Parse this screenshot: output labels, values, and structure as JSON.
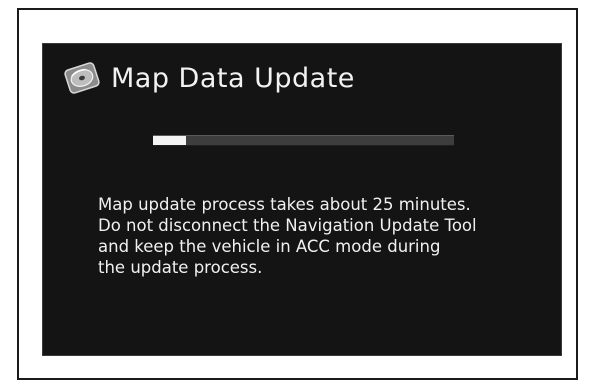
{
  "dialog": {
    "title": "Map Data Update",
    "icon": "disc-icon",
    "progress": 0.11,
    "message_lines": [
      "Map update process takes about 25 minutes.",
      "Do not disconnect the Navigation Update Tool",
      "and keep the vehicle in ACC mode during",
      "the update process."
    ]
  },
  "colors": {
    "screen_background": "#141414",
    "text": "#f0f0f0",
    "progress_track": "#3d3d3d",
    "progress_fill": "#f4f4f4"
  }
}
